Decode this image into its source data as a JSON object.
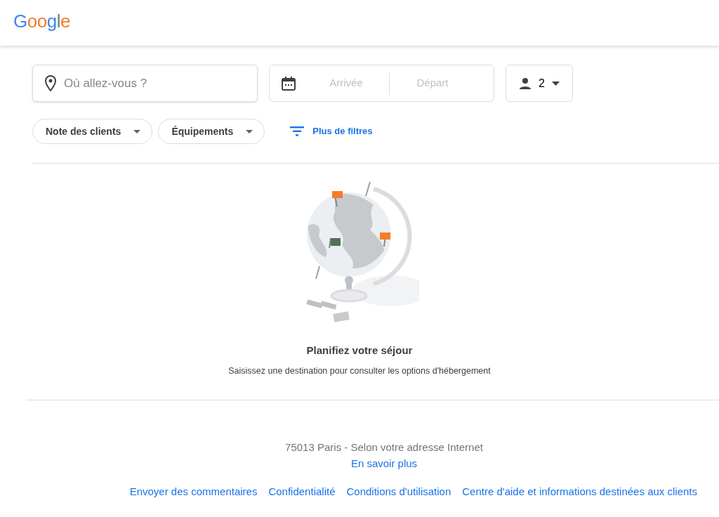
{
  "header": {
    "logo": "Google"
  },
  "search": {
    "destination": {
      "placeholder": "Où allez-vous ?"
    },
    "check_in": {
      "placeholder": "Arrivée"
    },
    "check_out": {
      "placeholder": "Départ"
    },
    "guests": "2"
  },
  "filters": [
    {
      "label": "Note des clients",
      "kind": "dropdown"
    },
    {
      "label": "Équipements",
      "kind": "dropdown"
    },
    {
      "label": "Plus de filtres",
      "kind": "link"
    }
  ],
  "empty_state": {
    "title": "Planifiez votre séjour",
    "message": "Saisissez une destination pour consulter les options d'hébergement"
  },
  "footer": {
    "location": "75013 Paris - Selon votre adresse Internet",
    "learn_more": "En savoir plus",
    "links": [
      "Envoyer des commentaires",
      "Confidentialité",
      "Conditions d'utilisation",
      "Centre d'aide et informations destinées aux clients"
    ]
  }
}
